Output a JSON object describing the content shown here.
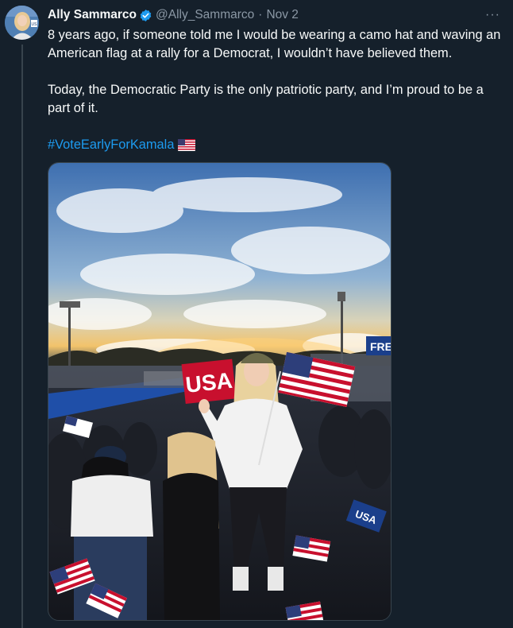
{
  "tweet": {
    "author_name": "Ally Sammarco",
    "handle": "@Ally_Sammarco",
    "separator": "·",
    "date": "Nov 2",
    "more_label": "···",
    "paragraph1": "8 years ago, if someone told me I would be wearing a camo hat and waving an American flag at a rally for a Democrat, I wouldn’t have believed them.",
    "paragraph2": "Today, the Democratic Party is the only patriotic party, and I’m proud to be a part of it.",
    "hashtag": "#VoteEarlyForKamala",
    "hashtag_emoji": "us-flag-emoji"
  },
  "photo": {
    "sign_text": "USA",
    "banner_text": "FREE",
    "small_sign_text": "USA"
  },
  "colors": {
    "background": "#15202b",
    "text": "#f7f9f9",
    "secondary": "#8b98a5",
    "accent": "#1d9bf0",
    "border": "#38444d"
  }
}
